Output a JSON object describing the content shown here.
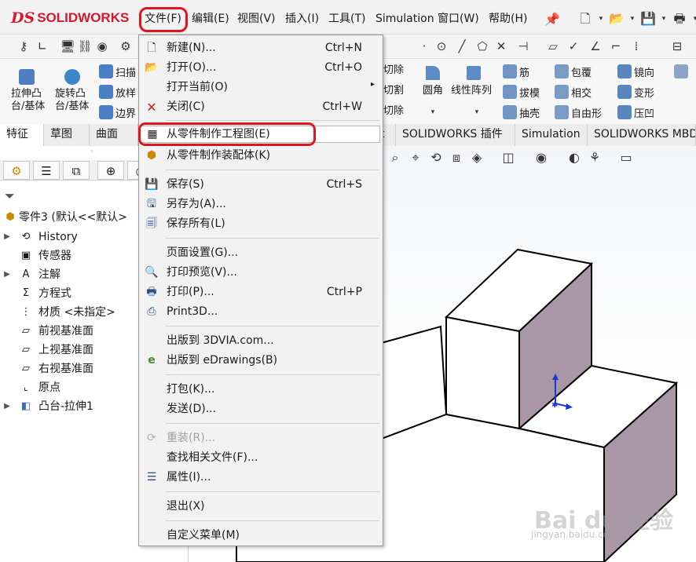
{
  "app": {
    "logo_ds": "DS",
    "logo_text": "SOLIDWORKS"
  },
  "menubar": {
    "items": [
      {
        "label": "文件(F)"
      },
      {
        "label": "编辑(E)"
      },
      {
        "label": "视图(V)"
      },
      {
        "label": "插入(I)"
      },
      {
        "label": "工具(T)"
      },
      {
        "label": "Simulation"
      },
      {
        "label": "窗口(W)"
      },
      {
        "label": "帮助(H)"
      }
    ]
  },
  "ribbon": {
    "extrude_boss_line1": "拉伸凸",
    "extrude_boss_line2": "台/基体",
    "revolve_boss_line1": "旋转凸",
    "revolve_boss_line2": "台/基体",
    "sweep": "扫描",
    "loft": "放样",
    "boundary": "边界",
    "cut1": "切除",
    "cut2": "切割",
    "cut3": "切除",
    "fillet": "圆角",
    "linear_pattern": "线性阵列",
    "rib": "筋",
    "draft": "拔模",
    "shell": "抽壳",
    "wrap": "包覆",
    "intersect": "相交",
    "freeform": "自由形",
    "mirror": "镜向",
    "deform": "变形",
    "indent": "压凹",
    "more": "5"
  },
  "tabs": {
    "features": "特征",
    "sketch": "草图",
    "surfaces": "曲面",
    "partial": "t",
    "addins": "SOLIDWORKS 插件",
    "simulation": "Simulation",
    "mbd": "SOLIDWORKS MBD"
  },
  "tree": {
    "root": "零件3 (默认<<默认>",
    "items": [
      {
        "label": "History"
      },
      {
        "label": "传感器"
      },
      {
        "label": "注解"
      },
      {
        "label": "方程式"
      },
      {
        "label": "材质 <未指定>"
      },
      {
        "label": "前视基准面"
      },
      {
        "label": "上视基准面"
      },
      {
        "label": "右视基准面"
      },
      {
        "label": "原点"
      },
      {
        "label": "凸台-拉伸1"
      }
    ]
  },
  "file_menu": {
    "new": {
      "label": "新建(N)...",
      "shortcut": "Ctrl+N"
    },
    "open": {
      "label": "打开(O)...",
      "shortcut": "Ctrl+O"
    },
    "open_current": {
      "label": "打开当前(O)"
    },
    "close": {
      "label": "关闭(C)",
      "shortcut": "Ctrl+W"
    },
    "make_drawing": {
      "label": "从零件制作工程图(E)"
    },
    "make_assembly": {
      "label": "从零件制作装配体(K)"
    },
    "save": {
      "label": "保存(S)",
      "shortcut": "Ctrl+S"
    },
    "save_as": {
      "label": "另存为(A)..."
    },
    "save_all": {
      "label": "保存所有(L)"
    },
    "page_setup": {
      "label": "页面设置(G)..."
    },
    "print_preview": {
      "label": "打印预览(V)..."
    },
    "print": {
      "label": "打印(P)...",
      "shortcut": "Ctrl+P"
    },
    "print3d": {
      "label": "Print3D..."
    },
    "publish_3dvia": {
      "label": "出版到 3DVIA.com..."
    },
    "publish_edrawings": {
      "label": "出版到 eDrawings(B)"
    },
    "pack_and_go": {
      "label": "打包(K)..."
    },
    "send": {
      "label": "发送(D)..."
    },
    "reload": {
      "label": "重装(R)..."
    },
    "find_references": {
      "label": "查找相关文件(F)..."
    },
    "properties": {
      "label": "属性(I)..."
    },
    "exit": {
      "label": "退出(X)"
    },
    "customize_menu": {
      "label": "自定义菜单(M)"
    }
  },
  "watermark": {
    "main": "Bai du 经验",
    "sub": "jingyan.baidu.com"
  },
  "colors": {
    "brand": "#d8172f",
    "highlight": "#e2141e",
    "model_side": "#a996a7",
    "axis": "#1a36d6"
  }
}
